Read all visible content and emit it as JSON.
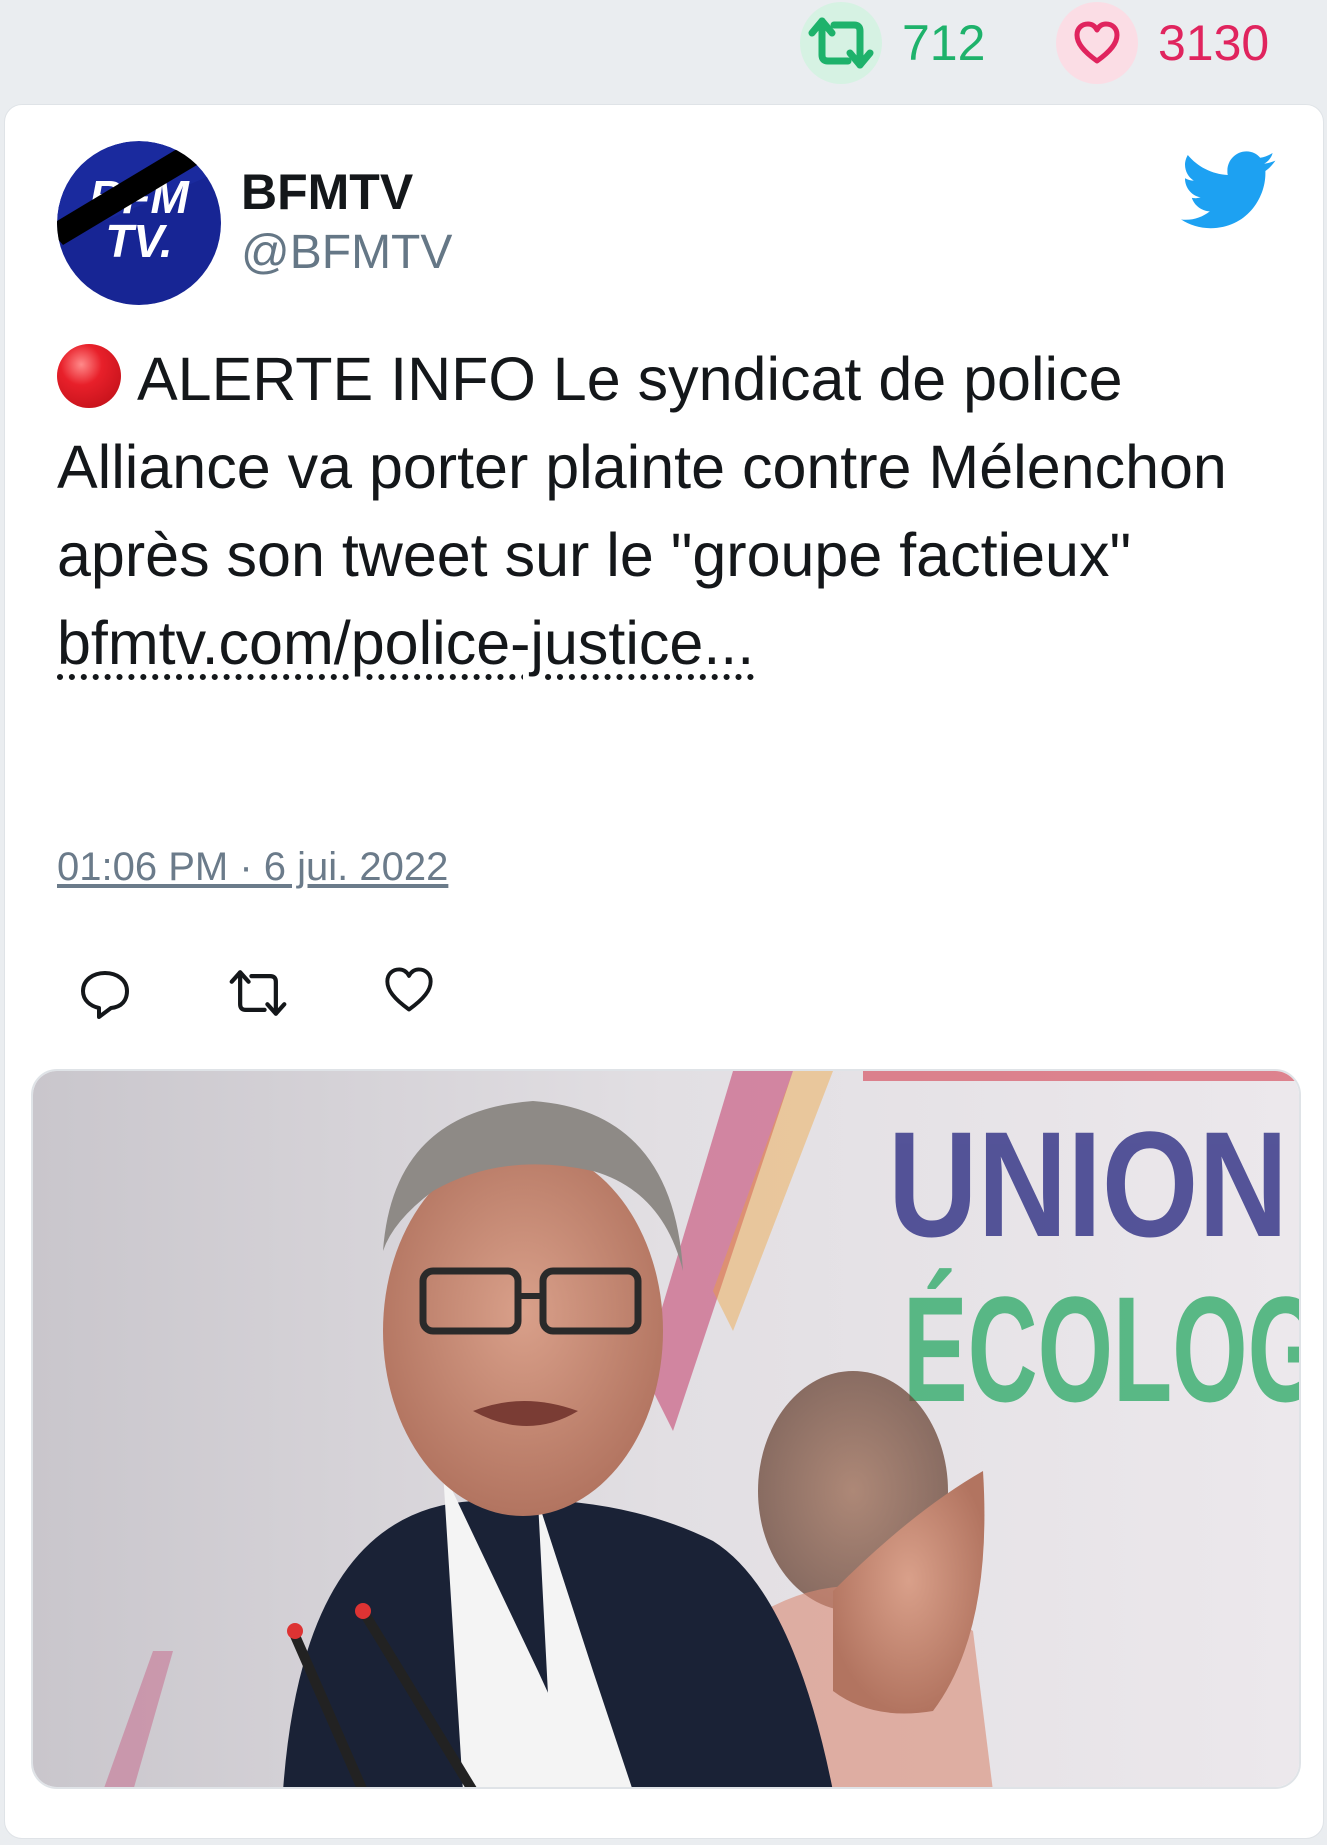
{
  "stats": {
    "retweets": "712",
    "likes": "3130",
    "retweet_color": "#1eb26b",
    "like_color": "#e0245e"
  },
  "tweet": {
    "display_name": "BFMTV",
    "handle": "@BFMTV",
    "avatar_text_top": "BFM",
    "avatar_text_bottom": "TV.",
    "alert_icon": "red-circle-icon",
    "text": "ALERTE INFO Le syndicat de police Alliance va porter plainte contre Mélenchon après son tweet sur le \"groupe factieux\" ",
    "link_text": "bfmtv.com/police-justice...",
    "timestamp": "01:06 PM · 6 jui. 2022",
    "actions": [
      "reply-icon",
      "retweet-icon",
      "like-icon"
    ],
    "media": {
      "sign_line1": "UNION",
      "sign_line2": "ÉCOLOG"
    },
    "brand_color": "#1da1f2"
  }
}
